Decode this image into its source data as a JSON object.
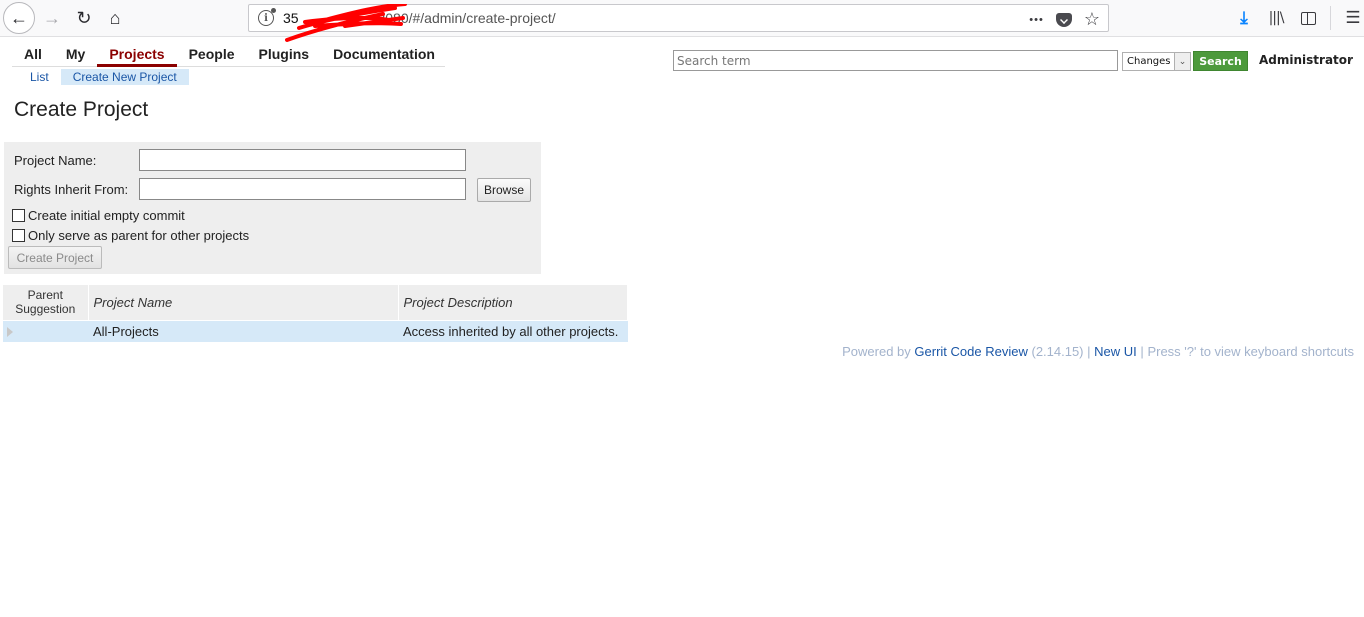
{
  "browser": {
    "url_visible_prefix": "35",
    "url_visible_suffix": ".8080/#/admin/create-project/",
    "back_icon": "←",
    "forward_icon": "→",
    "reload_icon": "↻",
    "home_icon": "⌂",
    "more_icon": "•••",
    "star_icon": "☆",
    "download_icon": "⤓",
    "library_icon": "|||\\",
    "menu_icon": "☰",
    "redaction_color": "#ff0000"
  },
  "topmenu": {
    "items": [
      {
        "label": "All",
        "active": false
      },
      {
        "label": "My",
        "active": false
      },
      {
        "label": "Projects",
        "active": true
      },
      {
        "label": "People",
        "active": false
      },
      {
        "label": "Plugins",
        "active": false
      },
      {
        "label": "Documentation",
        "active": false
      }
    ],
    "active_color": "#8b0000"
  },
  "submenu": {
    "items": [
      {
        "label": "List",
        "active": false
      },
      {
        "label": "Create New Project",
        "active": true
      }
    ]
  },
  "search": {
    "placeholder": "Search term",
    "value": "",
    "scope_selected": "Changes",
    "button_label": "Search",
    "button_color": "#4d9a3c"
  },
  "user": {
    "name": "Administrator",
    "caret": "▾"
  },
  "page": {
    "title": "Create Project"
  },
  "form": {
    "project_name_label": "Project Name:",
    "project_name_value": "",
    "rights_inherit_label": "Rights Inherit From:",
    "rights_inherit_value": "",
    "browse_label": "Browse",
    "checkbox_empty_commit_label": "Create initial empty commit",
    "checkbox_empty_commit_checked": false,
    "checkbox_parent_only_label": "Only serve as parent for other projects",
    "checkbox_parent_only_checked": false,
    "create_button_label": "Create Project",
    "create_button_enabled": false
  },
  "table": {
    "headers": {
      "parent": "Parent Suggestion",
      "name": "Project Name",
      "description": "Project Description"
    },
    "rows": [
      {
        "name": "All-Projects",
        "description": "Access inherited by all other projects."
      }
    ]
  },
  "footer": {
    "powered_by": "Powered by",
    "product_link": "Gerrit Code Review",
    "version": "(2.14.15)",
    "sep1": "|",
    "new_ui_link": "New UI",
    "sep2": "|",
    "shortcuts_hint": "Press '?' to view keyboard shortcuts"
  }
}
